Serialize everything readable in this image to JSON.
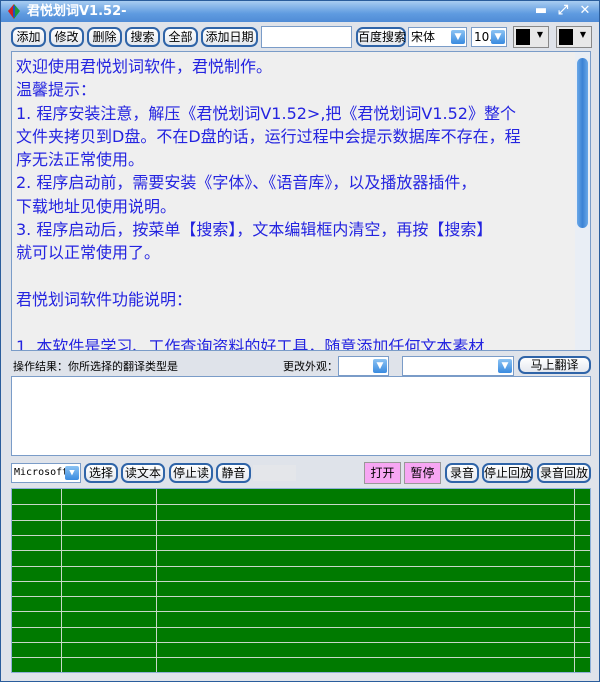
{
  "window": {
    "title": "君悦划词V1.52-",
    "controls": [
      "minimize",
      "maximize",
      "close"
    ]
  },
  "toolbar": {
    "add": "添加",
    "edit": "修改",
    "delete": "删除",
    "search": "搜索",
    "all": "全部",
    "add_date": "添加日期",
    "search_value": "",
    "baidu": "百度搜索",
    "font": "宋体",
    "font_size": "10.",
    "text_color": "#000000",
    "bg_color": "#000000"
  },
  "content": {
    "lines": [
      "欢迎使用君悦划词软件，君悦制作。",
      "温馨提示：",
      "1. 程序安装注意，解压《君悦划词V1.52>,把《君悦划词V1.52》整个",
      "文件夹拷贝到D盘。不在D盘的话，运行过程中会提示数据库不存在，程",
      "序无法正常使用。",
      "2. 程序启动前，需要安装《字体》、《语音库》，以及播放器插件，",
      "下载地址见使用说明。",
      "3. 程序启动后，按菜单【搜索】，文本编辑框内清空，再按【搜索】",
      "就可以正常使用了。",
      "",
      "君悦划词软件功能说明：",
      "",
      "1. 本软件是学习、工作查询资料的好工具，随意添加任何文本素材"
    ]
  },
  "status": {
    "result_label": "操作结果：你所选择的翻译类型是",
    "skin_label": "更改外观：",
    "skin_value": "",
    "translate_type": "",
    "translate_now": "马上翻译"
  },
  "audio": {
    "voice": "Microsoft",
    "select": "选择",
    "read_text": "读文本",
    "stop_read": "停止读",
    "mute": "静音",
    "open": "打开",
    "pause": "暂停",
    "record": "录音",
    "stop_playback": "停止回放",
    "record_playback": "录音回放"
  },
  "grid": {
    "rows": 12,
    "columns": 4,
    "color": "#007a00"
  }
}
